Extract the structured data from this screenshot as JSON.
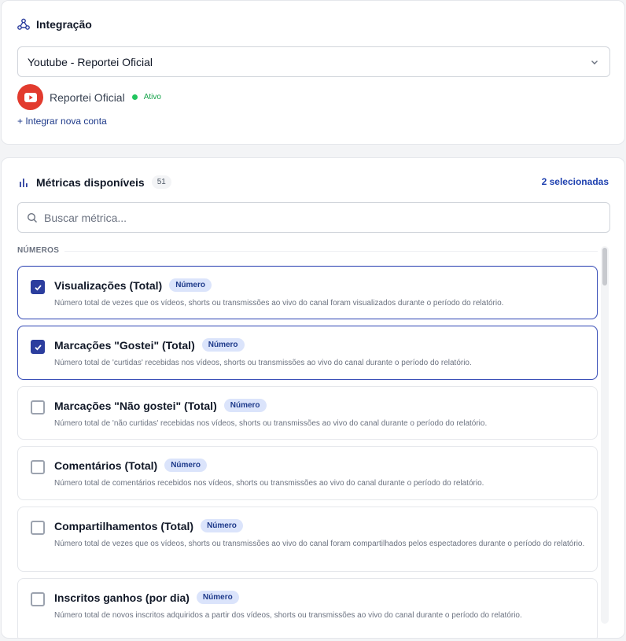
{
  "integration": {
    "title": "Integração",
    "icon": "integration-network-icon",
    "selected_integration": "Youtube - Reportei Oficial",
    "account": {
      "name": "Reportei Oficial",
      "status": "Ativo",
      "status_color": "#22c55e",
      "avatar_icon": "youtube-icon",
      "avatar_color": "#e23b2e"
    },
    "add_account_label": "+ Integrar nova conta"
  },
  "metrics": {
    "title": "Métricas disponíveis",
    "icon": "bar-chart-icon",
    "count": "51",
    "selected_label": "2 selecionadas",
    "search_placeholder": "Buscar métrica...",
    "group_label": "NÚMEROS",
    "accent_color": "#2c3e9e",
    "items": [
      {
        "title": "Visualizações (Total)",
        "tag": "Número",
        "description": "Número total de vezes que os vídeos, shorts ou transmissões ao vivo do canal foram visualizados durante o período do relatório.",
        "selected": true
      },
      {
        "title": "Marcações \"Gostei\" (Total)",
        "tag": "Número",
        "description": "Número total de 'curtidas' recebidas nos vídeos, shorts ou transmissões ao vivo do canal durante o período do relatório.",
        "selected": true
      },
      {
        "title": "Marcações \"Não gostei\" (Total)",
        "tag": "Número",
        "description": "Número total de 'não curtidas' recebidas nos vídeos, shorts ou transmissões ao vivo do canal durante o período do relatório.",
        "selected": false
      },
      {
        "title": "Comentários (Total)",
        "tag": "Número",
        "description": "Número total de comentários recebidos nos vídeos, shorts ou transmissões ao vivo do canal durante o período do relatório.",
        "selected": false
      },
      {
        "title": "Compartilhamentos (Total)",
        "tag": "Número",
        "description": "Número total de vezes que os vídeos, shorts ou transmissões ao vivo do canal foram compartilhados pelos espectadores durante o período do relatório.",
        "selected": false
      },
      {
        "title": "Inscritos ganhos (por dia)",
        "tag": "Número",
        "description": "Número total de novos inscritos adquiridos a partir dos vídeos, shorts ou transmissões ao vivo do canal durante o período do relatório.",
        "selected": false
      }
    ]
  }
}
